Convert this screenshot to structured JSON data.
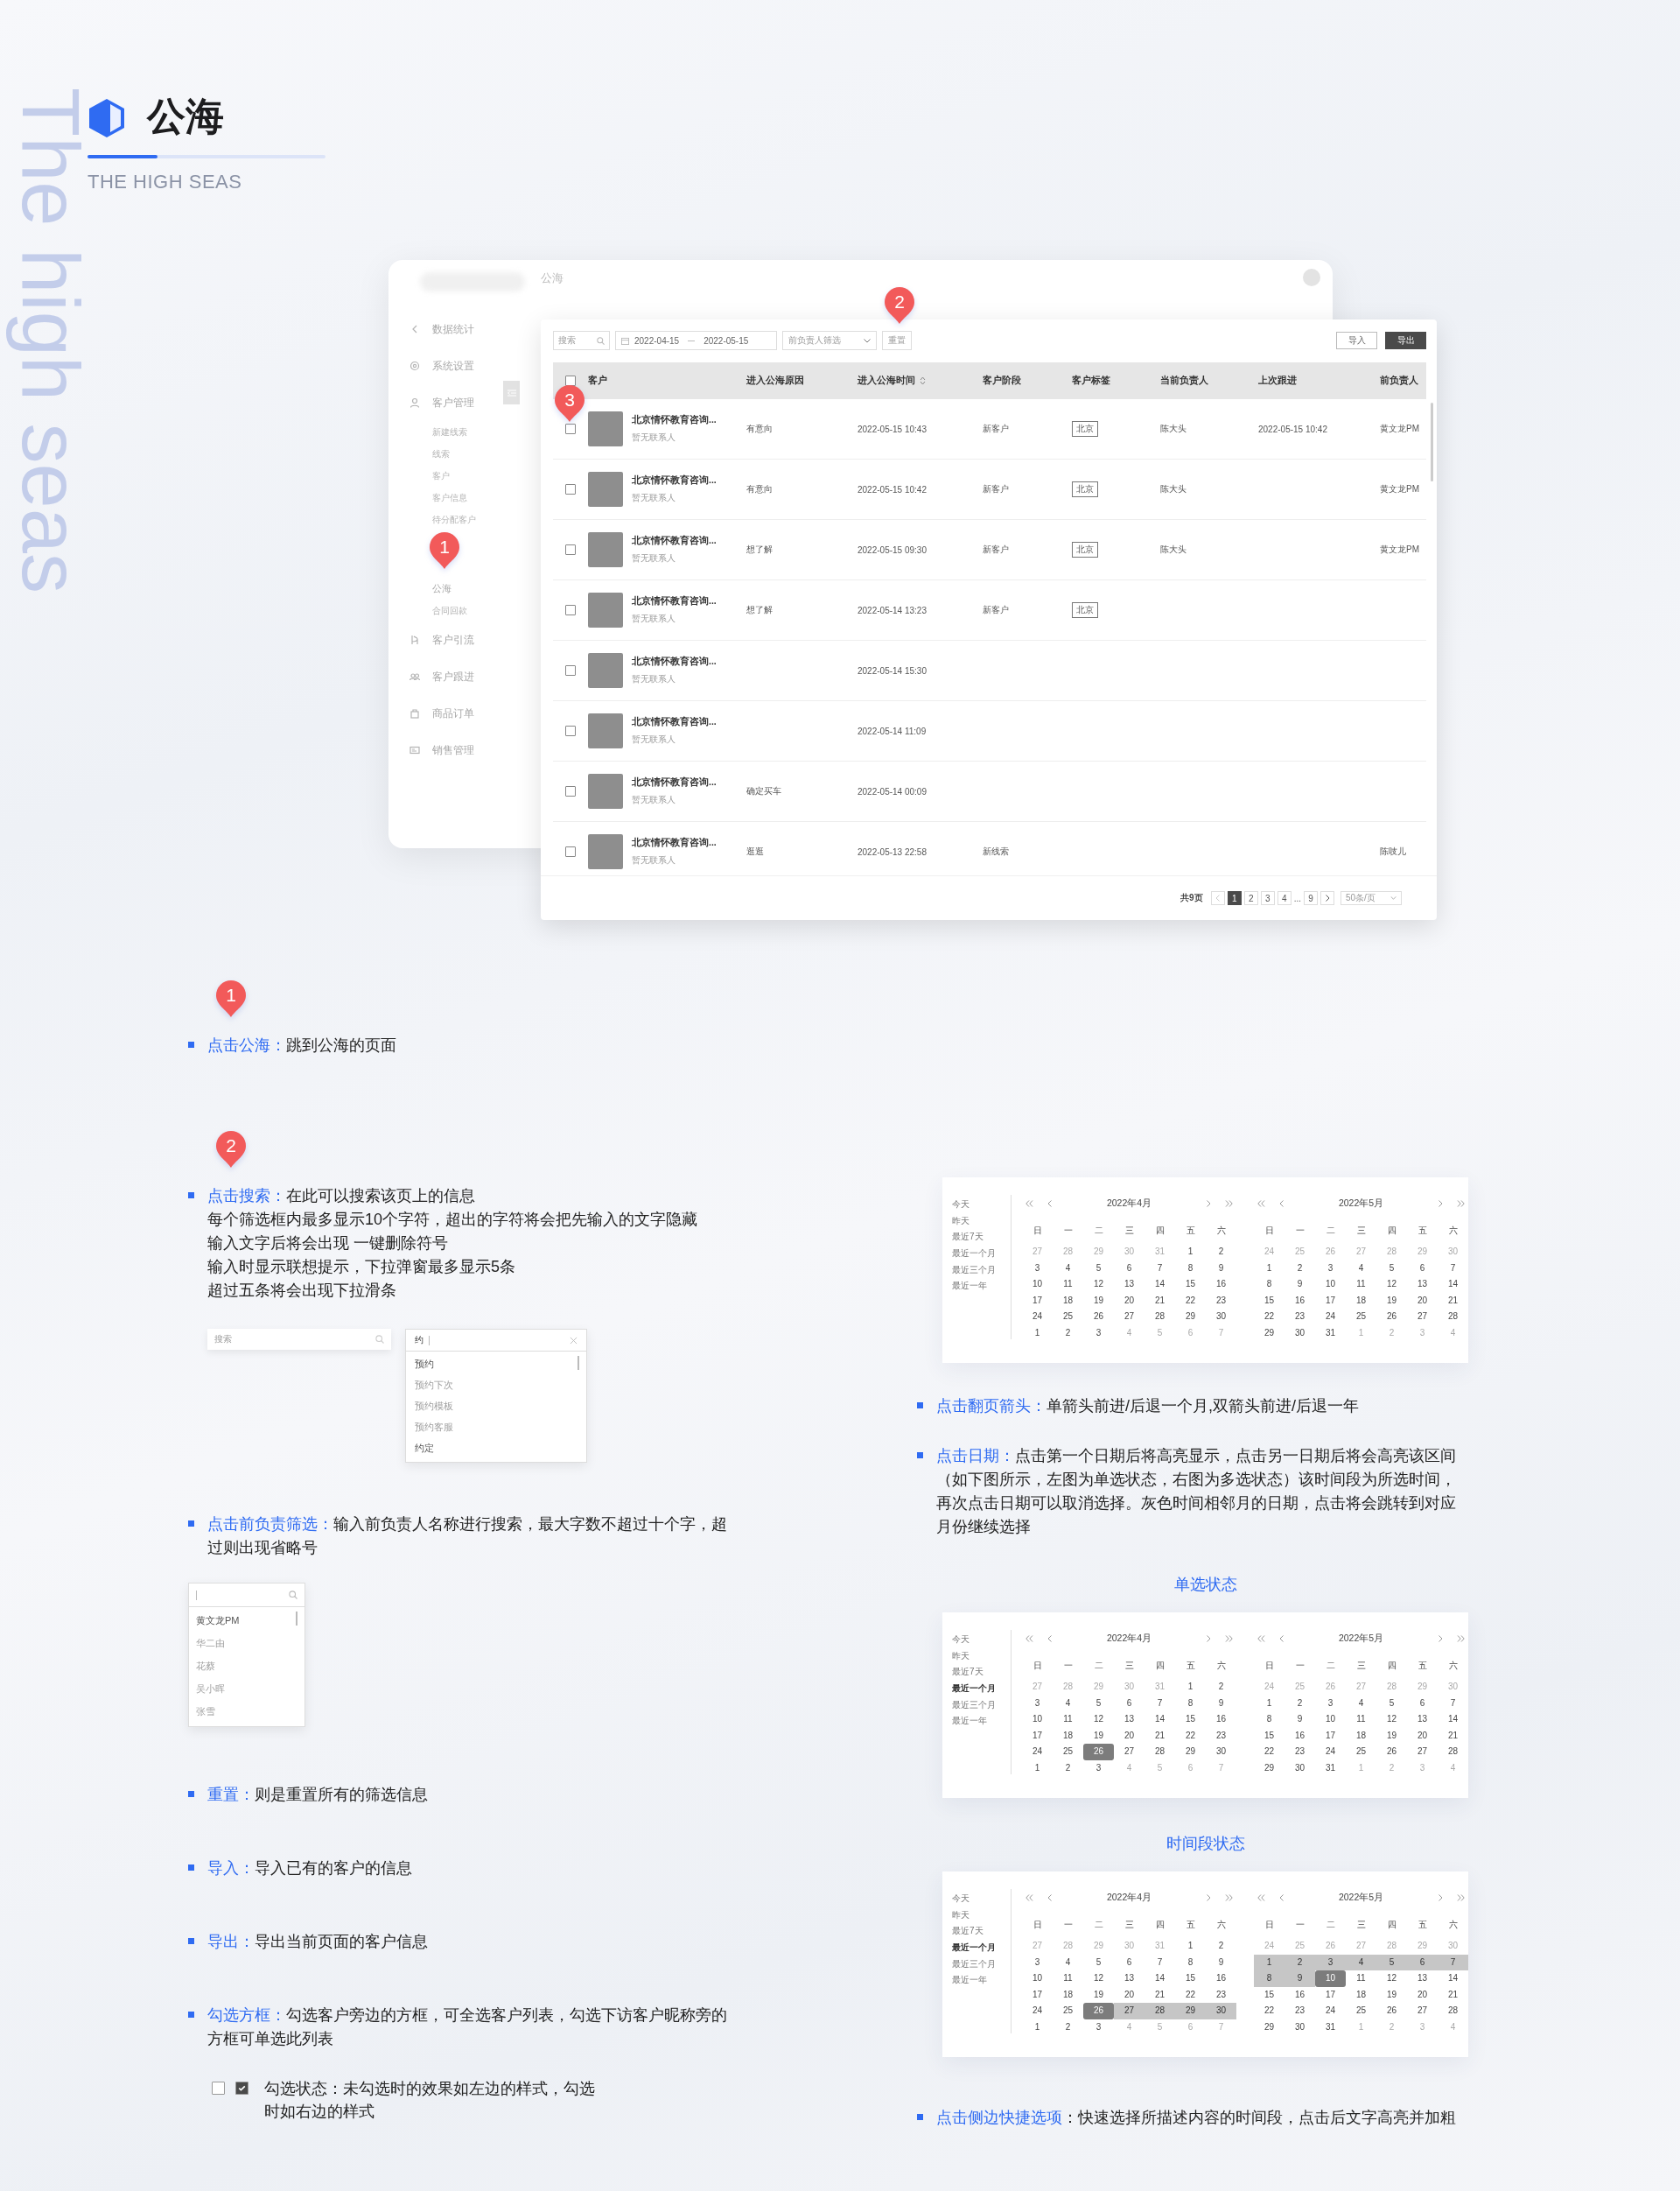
{
  "header": {
    "title": "公海",
    "subtitle": "THE HIGH SEAS",
    "side_caption": "The high seas"
  },
  "app": {
    "window_title": "公海",
    "sidebar": [
      {
        "label": "数据统计",
        "kind": "chevron"
      },
      {
        "label": "系统设置",
        "kind": "gear"
      },
      {
        "label": "客户管理",
        "kind": "person",
        "children": [
          {
            "label": "新建线索"
          },
          {
            "label": "线索"
          },
          {
            "label": "客户"
          },
          {
            "label": "客户信息"
          },
          {
            "label": "待分配客户"
          },
          {
            "label": "公海"
          },
          {
            "label": "合同回款"
          }
        ]
      },
      {
        "label": "客户引流",
        "kind": "branch"
      },
      {
        "label": "客户跟进",
        "kind": "people"
      },
      {
        "label": "商品订单",
        "kind": "bag"
      },
      {
        "label": "销售管理",
        "kind": "card"
      }
    ],
    "filters": {
      "search_placeholder": "搜索",
      "date_start": "2022-04-15",
      "date_end": "2022-05-15",
      "owner_placeholder": "前负责人筛选",
      "reset": "重置"
    },
    "actions": [
      {
        "label": "导入",
        "kind": "outline"
      },
      {
        "label": "导出",
        "kind": "solid"
      }
    ],
    "select_all_checked": false,
    "columns": [
      {
        "label": "客户",
        "sortable": false
      },
      {
        "label": "进入公海原因",
        "sortable": false
      },
      {
        "label": "进入公海时间",
        "sortable": true
      },
      {
        "label": "客户阶段",
        "sortable": false
      },
      {
        "label": "客户标签",
        "sortable": false
      },
      {
        "label": "当前负责人",
        "sortable": false
      },
      {
        "label": "上次跟进",
        "sortable": false
      },
      {
        "label": "前负责人",
        "sortable": false
      }
    ],
    "rows": [
      {
        "checked": false,
        "name": "北京情怀教育咨询...",
        "contact": "暂无联系人",
        "reason": "有意向",
        "time": "2022-05-15 10:43",
        "stage": "新客户",
        "tag": "北京",
        "owner": "陈大头",
        "last_follow": "2022-05-15 10:42",
        "prev_owner": "黄文龙PM"
      },
      {
        "checked": false,
        "name": "北京情怀教育咨询...",
        "contact": "暂无联系人",
        "reason": "有意向",
        "time": "2022-05-15 10:42",
        "stage": "新客户",
        "tag": "北京",
        "owner": "陈大头",
        "prev_owner": "黄文龙PM"
      },
      {
        "checked": false,
        "name": "北京情怀教育咨询...",
        "contact": "暂无联系人",
        "reason": "想了解",
        "time": "2022-05-15 09:30",
        "stage": "新客户",
        "tag": "北京",
        "owner": "陈大头",
        "prev_owner": "黄文龙PM"
      },
      {
        "checked": false,
        "name": "北京情怀教育咨询...",
        "contact": "暂无联系人",
        "reason": "想了解",
        "time": "2022-05-14 13:23",
        "stage": "新客户",
        "tag": "北京"
      },
      {
        "checked": false,
        "name": "北京情怀教育咨询...",
        "contact": "暂无联系人",
        "time": "2022-05-14 15:30"
      },
      {
        "checked": false,
        "name": "北京情怀教育咨询...",
        "contact": "暂无联系人",
        "time": "2022-05-14 11:09"
      },
      {
        "checked": false,
        "name": "北京情怀教育咨询...",
        "contact": "暂无联系人",
        "reason": "确定买车",
        "time": "2022-05-14 00:09"
      },
      {
        "checked": false,
        "name": "北京情怀教育咨询...",
        "contact": "暂无联系人",
        "reason": "逛逛",
        "time": "2022-05-13 22:58",
        "stage": "新线索",
        "prev_owner": "陈吱儿"
      }
    ],
    "pagination": {
      "total": "共9页",
      "prev_disabled": true,
      "pages": [
        {
          "label": "1",
          "kind": "page",
          "selected": true
        },
        {
          "label": "2",
          "kind": "page",
          "selected": false
        },
        {
          "label": "3",
          "kind": "page",
          "selected": false
        },
        {
          "label": "4",
          "kind": "page",
          "selected": false
        },
        {
          "label": "...",
          "kind": "ellipsis"
        },
        {
          "label": "9",
          "kind": "page",
          "selected": false
        }
      ],
      "page_size": "50条/页"
    },
    "pins": [
      "1",
      "2",
      "3"
    ]
  },
  "notes_left": [
    {
      "kind": "note",
      "pin": "1",
      "term": "点击公海：",
      "lines": [
        "跳到公海的页面"
      ]
    },
    {
      "kind": "note",
      "pin": "2",
      "term": "点击搜索：",
      "lines": [
        "在此可以搜索该页上的信息",
        "每个筛选框内最多显示10个字符，超出的字符将会把先输入的文字隐藏",
        "输入文字后将会出现 一键删除符号",
        "输入时显示联想提示，下拉弹窗最多显示5条",
        "超过五条将会出现下拉滑条"
      ]
    },
    {
      "kind": "search_demo",
      "placeholder": "搜索",
      "value": "约",
      "suggestions": [
        {
          "label": "预约",
          "emphasis": true
        },
        {
          "label": "预约下次",
          "emphasis": false
        },
        {
          "label": "预约模板",
          "emphasis": false
        },
        {
          "label": "预约客服",
          "emphasis": false
        },
        {
          "label": "约定",
          "emphasis": true
        }
      ]
    },
    {
      "kind": "note",
      "term": "点击前负责筛选：",
      "lines": [
        "输入前负责人名称进行搜索，最大字数不超过十个字，超过则出现省略号"
      ]
    },
    {
      "kind": "owner_demo",
      "options": [
        {
          "label": "黄文龙PM",
          "emphasis": true
        },
        {
          "label": "华二由",
          "emphasis": false
        },
        {
          "label": "花蔡",
          "emphasis": false
        },
        {
          "label": "吴小晖",
          "emphasis": false
        },
        {
          "label": "张雪",
          "emphasis": false
        }
      ]
    },
    {
      "kind": "note",
      "term": "重置：",
      "lines": [
        "则是重置所有的筛选信息"
      ]
    },
    {
      "kind": "note",
      "term": "导入：",
      "lines": [
        "导入已有的客户的信息"
      ]
    },
    {
      "kind": "note",
      "term": "导出：",
      "lines": [
        "导出当前页面的客户信息"
      ]
    },
    {
      "kind": "note",
      "term": "勾选方框：",
      "lines": [
        "勾选客户旁边的方框，可全选客户列表，勾选下访客户昵称旁的方框可单选此列表"
      ]
    },
    {
      "kind": "checkbox_demo",
      "boxes": [
        {
          "checked": false
        },
        {
          "checked": true
        }
      ],
      "text": "勾选状态：未勾选时的效果如左边的样式，勾选时如右边的样式"
    }
  ],
  "notes_right": [
    {
      "kind": "calendar",
      "shortcuts": [
        {
          "label": "今天",
          "selected": false
        },
        {
          "label": "昨天",
          "selected": false
        },
        {
          "label": "最近7天",
          "selected": false
        },
        {
          "label": "最近一个月",
          "selected": false
        },
        {
          "label": "最近三个月",
          "selected": false
        },
        {
          "label": "最近一年",
          "selected": false
        }
      ],
      "months": [
        {
          "title": "2022年4月",
          "weekdays": [
            "日",
            "一",
            "二",
            "三",
            "四",
            "五",
            "六"
          ],
          "weeks": [
            [
              {
                "day": "27",
                "kind": "muted"
              },
              {
                "day": "28",
                "kind": "muted"
              },
              {
                "day": "29",
                "kind": "muted"
              },
              {
                "day": "30",
                "kind": "muted"
              },
              {
                "day": "31",
                "kind": "muted"
              },
              {
                "day": "1",
                "kind": "normal"
              },
              {
                "day": "2",
                "kind": "normal"
              }
            ],
            [
              {
                "day": "3",
                "kind": "normal"
              },
              {
                "day": "4",
                "kind": "normal"
              },
              {
                "day": "5",
                "kind": "normal"
              },
              {
                "day": "6",
                "kind": "normal"
              },
              {
                "day": "7",
                "kind": "normal"
              },
              {
                "day": "8",
                "kind": "normal"
              },
              {
                "day": "9",
                "kind": "normal"
              }
            ],
            [
              {
                "day": "10",
                "kind": "normal"
              },
              {
                "day": "11",
                "kind": "normal"
              },
              {
                "day": "12",
                "kind": "normal"
              },
              {
                "day": "13",
                "kind": "normal"
              },
              {
                "day": "14",
                "kind": "normal"
              },
              {
                "day": "15",
                "kind": "normal"
              },
              {
                "day": "16",
                "kind": "normal"
              }
            ],
            [
              {
                "day": "17",
                "kind": "normal"
              },
              {
                "day": "18",
                "kind": "normal"
              },
              {
                "day": "19",
                "kind": "normal"
              },
              {
                "day": "20",
                "kind": "normal"
              },
              {
                "day": "21",
                "kind": "normal"
              },
              {
                "day": "22",
                "kind": "normal"
              },
              {
                "day": "23",
                "kind": "normal"
              }
            ],
            [
              {
                "day": "24",
                "kind": "normal"
              },
              {
                "day": "25",
                "kind": "normal"
              },
              {
                "day": "26",
                "kind": "normal"
              },
              {
                "day": "27",
                "kind": "normal"
              },
              {
                "day": "28",
                "kind": "normal"
              },
              {
                "day": "29",
                "kind": "normal"
              },
              {
                "day": "30",
                "kind": "normal"
              }
            ],
            [
              {
                "day": "1",
                "kind": "normal"
              },
              {
                "day": "2",
                "kind": "normal"
              },
              {
                "day": "3",
                "kind": "normal"
              },
              {
                "day": "4",
                "kind": "muted"
              },
              {
                "day": "5",
                "kind": "muted"
              },
              {
                "day": "6",
                "kind": "muted"
              },
              {
                "day": "7",
                "kind": "muted"
              }
            ]
          ]
        },
        {
          "title": "2022年5月",
          "weekdays": [
            "日",
            "一",
            "二",
            "三",
            "四",
            "五",
            "六"
          ],
          "weeks": [
            [
              {
                "day": "24",
                "kind": "muted"
              },
              {
                "day": "25",
                "kind": "muted"
              },
              {
                "day": "26",
                "kind": "muted"
              },
              {
                "day": "27",
                "kind": "muted"
              },
              {
                "day": "28",
                "kind": "muted"
              },
              {
                "day": "29",
                "kind": "muted"
              },
              {
                "day": "30",
                "kind": "muted"
              }
            ],
            [
              {
                "day": "1",
                "kind": "normal"
              },
              {
                "day": "2",
                "kind": "normal"
              },
              {
                "day": "3",
                "kind": "normal"
              },
              {
                "day": "4",
                "kind": "normal"
              },
              {
                "day": "5",
                "kind": "normal"
              },
              {
                "day": "6",
                "kind": "normal"
              },
              {
                "day": "7",
                "kind": "normal"
              }
            ],
            [
              {
                "day": "8",
                "kind": "normal"
              },
              {
                "day": "9",
                "kind": "normal"
              },
              {
                "day": "10",
                "kind": "normal"
              },
              {
                "day": "11",
                "kind": "normal"
              },
              {
                "day": "12",
                "kind": "normal"
              },
              {
                "day": "13",
                "kind": "normal"
              },
              {
                "day": "14",
                "kind": "normal"
              }
            ],
            [
              {
                "day": "15",
                "kind": "normal"
              },
              {
                "day": "16",
                "kind": "normal"
              },
              {
                "day": "17",
                "kind": "normal"
              },
              {
                "day": "18",
                "kind": "normal"
              },
              {
                "day": "19",
                "kind": "normal"
              },
              {
                "day": "20",
                "kind": "normal"
              },
              {
                "day": "21",
                "kind": "normal"
              }
            ],
            [
              {
                "day": "22",
                "kind": "normal"
              },
              {
                "day": "23",
                "kind": "normal"
              },
              {
                "day": "24",
                "kind": "normal"
              },
              {
                "day": "25",
                "kind": "normal"
              },
              {
                "day": "26",
                "kind": "normal"
              },
              {
                "day": "27",
                "kind": "normal"
              },
              {
                "day": "28",
                "kind": "normal"
              }
            ],
            [
              {
                "day": "29",
                "kind": "normal"
              },
              {
                "day": "30",
                "kind": "normal"
              },
              {
                "day": "31",
                "kind": "normal"
              },
              {
                "day": "1",
                "kind": "muted"
              },
              {
                "day": "2",
                "kind": "muted"
              },
              {
                "day": "3",
                "kind": "muted"
              },
              {
                "day": "4",
                "kind": "muted"
              }
            ]
          ]
        }
      ]
    },
    {
      "kind": "note",
      "term": "点击翻页箭头：",
      "text": "单箭头前进/后退一个月,双箭头前进/后退一年"
    },
    {
      "kind": "note",
      "term": "点击日期：",
      "text": "点击第一个日期后将高亮显示，点击另一日期后将会高亮该区间（如下图所示，左图为单选状态，右图为多选状态）该时间段为所选时间，再次点击日期可以取消选择。灰色时间相邻月的日期，点击将会跳转到对应月份继续选择"
    },
    {
      "kind": "heading",
      "text": "单选状态"
    },
    {
      "kind": "calendar",
      "shortcuts": [
        {
          "label": "今天",
          "selected": false
        },
        {
          "label": "昨天",
          "selected": false
        },
        {
          "label": "最近7天",
          "selected": false
        },
        {
          "label": "最近一个月",
          "selected": true
        },
        {
          "label": "最近三个月",
          "selected": false
        },
        {
          "label": "最近一年",
          "selected": false
        }
      ],
      "months": [
        {
          "title": "2022年4月",
          "weekdays": [
            "日",
            "一",
            "二",
            "三",
            "四",
            "五",
            "六"
          ],
          "weeks": [
            [
              {
                "day": "27",
                "kind": "muted"
              },
              {
                "day": "28",
                "kind": "muted"
              },
              {
                "day": "29",
                "kind": "muted"
              },
              {
                "day": "30",
                "kind": "muted"
              },
              {
                "day": "31",
                "kind": "muted"
              },
              {
                "day": "1",
                "kind": "normal"
              },
              {
                "day": "2",
                "kind": "normal"
              }
            ],
            [
              {
                "day": "3",
                "kind": "normal"
              },
              {
                "day": "4",
                "kind": "normal"
              },
              {
                "day": "5",
                "kind": "normal"
              },
              {
                "day": "6",
                "kind": "normal"
              },
              {
                "day": "7",
                "kind": "normal"
              },
              {
                "day": "8",
                "kind": "normal"
              },
              {
                "day": "9",
                "kind": "normal"
              }
            ],
            [
              {
                "day": "10",
                "kind": "normal"
              },
              {
                "day": "11",
                "kind": "normal"
              },
              {
                "day": "12",
                "kind": "normal"
              },
              {
                "day": "13",
                "kind": "normal"
              },
              {
                "day": "14",
                "kind": "normal"
              },
              {
                "day": "15",
                "kind": "normal"
              },
              {
                "day": "16",
                "kind": "normal"
              }
            ],
            [
              {
                "day": "17",
                "kind": "normal"
              },
              {
                "day": "18",
                "kind": "normal"
              },
              {
                "day": "19",
                "kind": "normal"
              },
              {
                "day": "20",
                "kind": "normal"
              },
              {
                "day": "21",
                "kind": "normal"
              },
              {
                "day": "22",
                "kind": "normal"
              },
              {
                "day": "23",
                "kind": "normal"
              }
            ],
            [
              {
                "day": "24",
                "kind": "normal"
              },
              {
                "day": "25",
                "kind": "normal"
              },
              {
                "day": "26",
                "kind": "selected"
              },
              {
                "day": "27",
                "kind": "normal"
              },
              {
                "day": "28",
                "kind": "normal"
              },
              {
                "day": "29",
                "kind": "normal"
              },
              {
                "day": "30",
                "kind": "normal"
              }
            ],
            [
              {
                "day": "1",
                "kind": "normal"
              },
              {
                "day": "2",
                "kind": "normal"
              },
              {
                "day": "3",
                "kind": "normal"
              },
              {
                "day": "4",
                "kind": "muted"
              },
              {
                "day": "5",
                "kind": "muted"
              },
              {
                "day": "6",
                "kind": "muted"
              },
              {
                "day": "7",
                "kind": "muted"
              }
            ]
          ]
        },
        {
          "title": "2022年5月",
          "weekdays": [
            "日",
            "一",
            "二",
            "三",
            "四",
            "五",
            "六"
          ],
          "weeks": [
            [
              {
                "day": "24",
                "kind": "muted"
              },
              {
                "day": "25",
                "kind": "muted"
              },
              {
                "day": "26",
                "kind": "muted"
              },
              {
                "day": "27",
                "kind": "muted"
              },
              {
                "day": "28",
                "kind": "muted"
              },
              {
                "day": "29",
                "kind": "muted"
              },
              {
                "day": "30",
                "kind": "muted"
              }
            ],
            [
              {
                "day": "1",
                "kind": "normal"
              },
              {
                "day": "2",
                "kind": "normal"
              },
              {
                "day": "3",
                "kind": "normal"
              },
              {
                "day": "4",
                "kind": "normal"
              },
              {
                "day": "5",
                "kind": "normal"
              },
              {
                "day": "6",
                "kind": "normal"
              },
              {
                "day": "7",
                "kind": "normal"
              }
            ],
            [
              {
                "day": "8",
                "kind": "normal"
              },
              {
                "day": "9",
                "kind": "normal"
              },
              {
                "day": "10",
                "kind": "normal"
              },
              {
                "day": "11",
                "kind": "normal"
              },
              {
                "day": "12",
                "kind": "normal"
              },
              {
                "day": "13",
                "kind": "normal"
              },
              {
                "day": "14",
                "kind": "normal"
              }
            ],
            [
              {
                "day": "15",
                "kind": "normal"
              },
              {
                "day": "16",
                "kind": "normal"
              },
              {
                "day": "17",
                "kind": "normal"
              },
              {
                "day": "18",
                "kind": "normal"
              },
              {
                "day": "19",
                "kind": "normal"
              },
              {
                "day": "20",
                "kind": "normal"
              },
              {
                "day": "21",
                "kind": "normal"
              }
            ],
            [
              {
                "day": "22",
                "kind": "normal"
              },
              {
                "day": "23",
                "kind": "normal"
              },
              {
                "day": "24",
                "kind": "normal"
              },
              {
                "day": "25",
                "kind": "normal"
              },
              {
                "day": "26",
                "kind": "normal"
              },
              {
                "day": "27",
                "kind": "normal"
              },
              {
                "day": "28",
                "kind": "normal"
              }
            ],
            [
              {
                "day": "29",
                "kind": "normal"
              },
              {
                "day": "30",
                "kind": "normal"
              },
              {
                "day": "31",
                "kind": "normal"
              },
              {
                "day": "1",
                "kind": "muted"
              },
              {
                "day": "2",
                "kind": "muted"
              },
              {
                "day": "3",
                "kind": "muted"
              },
              {
                "day": "4",
                "kind": "muted"
              }
            ]
          ]
        }
      ]
    },
    {
      "kind": "heading",
      "text": "时间段状态"
    },
    {
      "kind": "calendar",
      "shortcuts": [
        {
          "label": "今天",
          "selected": false
        },
        {
          "label": "昨天",
          "selected": false
        },
        {
          "label": "最近7天",
          "selected": false
        },
        {
          "label": "最近一个月",
          "selected": true
        },
        {
          "label": "最近三个月",
          "selected": false
        },
        {
          "label": "最近一年",
          "selected": false
        }
      ],
      "months": [
        {
          "title": "2022年4月",
          "weekdays": [
            "日",
            "一",
            "二",
            "三",
            "四",
            "五",
            "六"
          ],
          "weeks": [
            [
              {
                "day": "27",
                "kind": "muted"
              },
              {
                "day": "28",
                "kind": "muted"
              },
              {
                "day": "29",
                "kind": "muted"
              },
              {
                "day": "30",
                "kind": "muted"
              },
              {
                "day": "31",
                "kind": "muted"
              },
              {
                "day": "1",
                "kind": "normal"
              },
              {
                "day": "2",
                "kind": "normal"
              }
            ],
            [
              {
                "day": "3",
                "kind": "normal"
              },
              {
                "day": "4",
                "kind": "normal"
              },
              {
                "day": "5",
                "kind": "normal"
              },
              {
                "day": "6",
                "kind": "normal"
              },
              {
                "day": "7",
                "kind": "normal"
              },
              {
                "day": "8",
                "kind": "normal"
              },
              {
                "day": "9",
                "kind": "normal"
              }
            ],
            [
              {
                "day": "10",
                "kind": "normal"
              },
              {
                "day": "11",
                "kind": "normal"
              },
              {
                "day": "12",
                "kind": "normal"
              },
              {
                "day": "13",
                "kind": "normal"
              },
              {
                "day": "14",
                "kind": "normal"
              },
              {
                "day": "15",
                "kind": "normal"
              },
              {
                "day": "16",
                "kind": "normal"
              }
            ],
            [
              {
                "day": "17",
                "kind": "normal"
              },
              {
                "day": "18",
                "kind": "normal"
              },
              {
                "day": "19",
                "kind": "normal"
              },
              {
                "day": "20",
                "kind": "normal"
              },
              {
                "day": "21",
                "kind": "normal"
              },
              {
                "day": "22",
                "kind": "normal"
              },
              {
                "day": "23",
                "kind": "normal"
              }
            ],
            [
              {
                "day": "24",
                "kind": "normal"
              },
              {
                "day": "25",
                "kind": "normal"
              },
              {
                "day": "26",
                "kind": "selected"
              },
              {
                "day": "27",
                "kind": "range"
              },
              {
                "day": "28",
                "kind": "range"
              },
              {
                "day": "29",
                "kind": "range"
              },
              {
                "day": "30",
                "kind": "range"
              }
            ],
            [
              {
                "day": "1",
                "kind": "normal"
              },
              {
                "day": "2",
                "kind": "normal"
              },
              {
                "day": "3",
                "kind": "normal"
              },
              {
                "day": "4",
                "kind": "muted"
              },
              {
                "day": "5",
                "kind": "muted"
              },
              {
                "day": "6",
                "kind": "muted"
              },
              {
                "day": "7",
                "kind": "muted"
              }
            ]
          ]
        },
        {
          "title": "2022年5月",
          "weekdays": [
            "日",
            "一",
            "二",
            "三",
            "四",
            "五",
            "六"
          ],
          "weeks": [
            [
              {
                "day": "24",
                "kind": "muted"
              },
              {
                "day": "25",
                "kind": "muted"
              },
              {
                "day": "26",
                "kind": "muted"
              },
              {
                "day": "27",
                "kind": "muted"
              },
              {
                "day": "28",
                "kind": "muted"
              },
              {
                "day": "29",
                "kind": "muted"
              },
              {
                "day": "30",
                "kind": "muted"
              }
            ],
            [
              {
                "day": "1",
                "kind": "range"
              },
              {
                "day": "2",
                "kind": "range"
              },
              {
                "day": "3",
                "kind": "range"
              },
              {
                "day": "4",
                "kind": "range"
              },
              {
                "day": "5",
                "kind": "range"
              },
              {
                "day": "6",
                "kind": "range"
              },
              {
                "day": "7",
                "kind": "range"
              }
            ],
            [
              {
                "day": "8",
                "kind": "range"
              },
              {
                "day": "9",
                "kind": "range"
              },
              {
                "day": "10",
                "kind": "selected"
              },
              {
                "day": "11",
                "kind": "normal"
              },
              {
                "day": "12",
                "kind": "normal"
              },
              {
                "day": "13",
                "kind": "normal"
              },
              {
                "day": "14",
                "kind": "normal"
              }
            ],
            [
              {
                "day": "15",
                "kind": "normal"
              },
              {
                "day": "16",
                "kind": "normal"
              },
              {
                "day": "17",
                "kind": "normal"
              },
              {
                "day": "18",
                "kind": "normal"
              },
              {
                "day": "19",
                "kind": "normal"
              },
              {
                "day": "20",
                "kind": "normal"
              },
              {
                "day": "21",
                "kind": "normal"
              }
            ],
            [
              {
                "day": "22",
                "kind": "normal"
              },
              {
                "day": "23",
                "kind": "normal"
              },
              {
                "day": "24",
                "kind": "normal"
              },
              {
                "day": "25",
                "kind": "normal"
              },
              {
                "day": "26",
                "kind": "normal"
              },
              {
                "day": "27",
                "kind": "normal"
              },
              {
                "day": "28",
                "kind": "normal"
              }
            ],
            [
              {
                "day": "29",
                "kind": "normal"
              },
              {
                "day": "30",
                "kind": "normal"
              },
              {
                "day": "31",
                "kind": "normal"
              },
              {
                "day": "1",
                "kind": "muted"
              },
              {
                "day": "2",
                "kind": "muted"
              },
              {
                "day": "3",
                "kind": "muted"
              },
              {
                "day": "4",
                "kind": "muted"
              }
            ]
          ]
        }
      ]
    },
    {
      "kind": "note",
      "term": "点击侧边快捷选项",
      "text": "：快速选择所描述内容的时间段，点击后文字高亮并加粗"
    }
  ]
}
